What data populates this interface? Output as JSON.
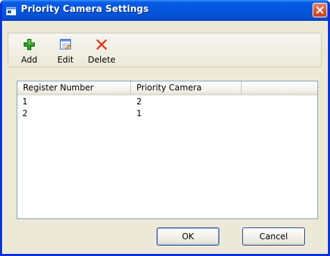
{
  "window": {
    "title": "Priority Camera Settings"
  },
  "toolbar": {
    "add_label": "Add",
    "edit_label": "Edit",
    "delete_label": "Delete"
  },
  "table": {
    "columns": [
      "Register Number",
      "Priority Camera",
      ""
    ],
    "rows": [
      [
        "1",
        "2"
      ],
      [
        "2",
        "1"
      ]
    ]
  },
  "buttons": {
    "ok_label": "OK",
    "cancel_label": "Cancel"
  },
  "colors": {
    "titlebar": "#0355d8",
    "close_button": "#d95a37",
    "dialog_bg": "#ece9d8",
    "add_icon": "#2e9e1f",
    "delete_icon": "#e8361b"
  },
  "icons": {
    "title": "window-icon",
    "close": "close-icon",
    "add": "green-plus-icon",
    "edit": "edit-document-icon",
    "delete": "red-x-icon"
  }
}
